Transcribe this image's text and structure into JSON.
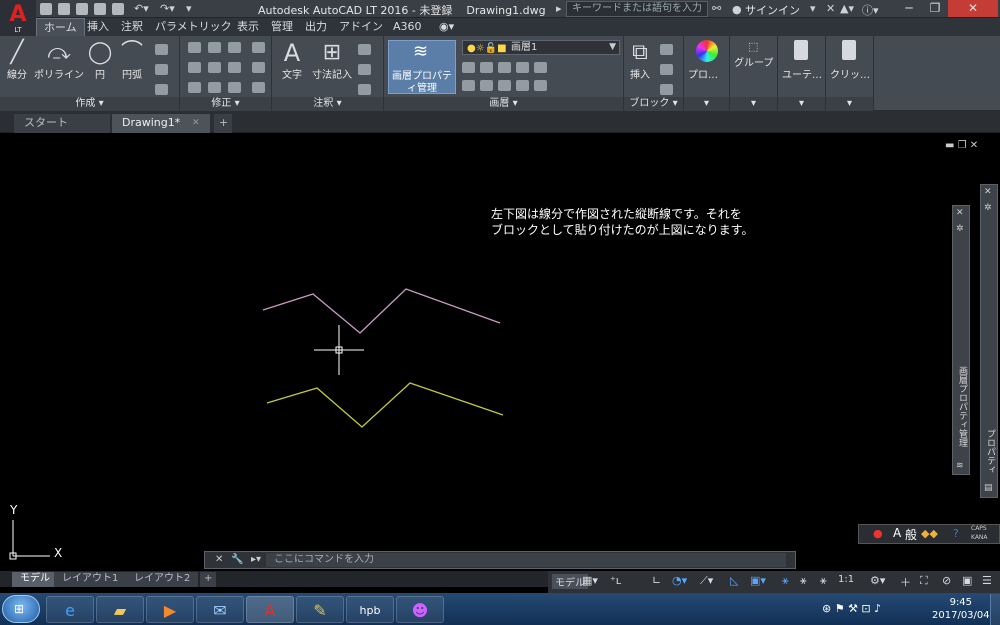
{
  "app": {
    "logo_letter": "A",
    "logo_sub": "LT"
  },
  "title": {
    "text": "Autodesk AutoCAD LT 2016 - 未登録    Drawing1.dwg"
  },
  "search": {
    "placeholder": "キーワードまたは語句を入力"
  },
  "signin": {
    "label": "サインイン"
  },
  "ribbon_tabs": [
    "ホーム",
    "挿入",
    "注釈",
    "パラメトリック",
    "表示",
    "管理",
    "出力",
    "アドイン",
    "A360"
  ],
  "panels": {
    "draw": {
      "label": "作成 ▾",
      "line": "線分",
      "polyline": "ポリライン",
      "circle": "円",
      "arc": "円弧"
    },
    "modify": {
      "label": "修正 ▾"
    },
    "annotation": {
      "label": "注釈 ▾",
      "text": "文字",
      "dimension": "寸法記入"
    },
    "layers": {
      "label": "画層 ▾",
      "layer_properties": "画層プロパティ管理",
      "current_layer": "画層1"
    },
    "block": {
      "label": "ブロック ▾",
      "insert": "挿入"
    },
    "properties": {
      "label": "プロ…"
    },
    "groups": {
      "label": "グループ"
    },
    "utilities": {
      "label": "ユーテ…"
    },
    "clipboard": {
      "label": "クリッ…"
    }
  },
  "file_tabs": [
    "スタート",
    "Drawing1*"
  ],
  "annotation_text": [
    "左下図は線分で作図された縦断線です。それを",
    "ブロックとして貼り付けたのが上図になります。"
  ],
  "side_panels": {
    "layer_palette": "画層プロパティ管理",
    "properties_palette": "プロパティ"
  },
  "ucs": {
    "x": "X",
    "y": "Y"
  },
  "command": {
    "placeholder": "ここにコマンドを入力"
  },
  "layout_tabs": [
    "モデル",
    "レイアウト1",
    "レイアウト2"
  ],
  "status": {
    "model": "モデル",
    "scale": "1:1"
  },
  "ime": {
    "mode": "般",
    "caps": "CAPS",
    "kana": "KANA"
  },
  "clock": {
    "time": "9:45",
    "date": "2017/03/04"
  },
  "colors": {
    "upper_polyline": "#c89ac4",
    "lower_polyline": "#c4c840",
    "accent": "#5a7ea8"
  }
}
